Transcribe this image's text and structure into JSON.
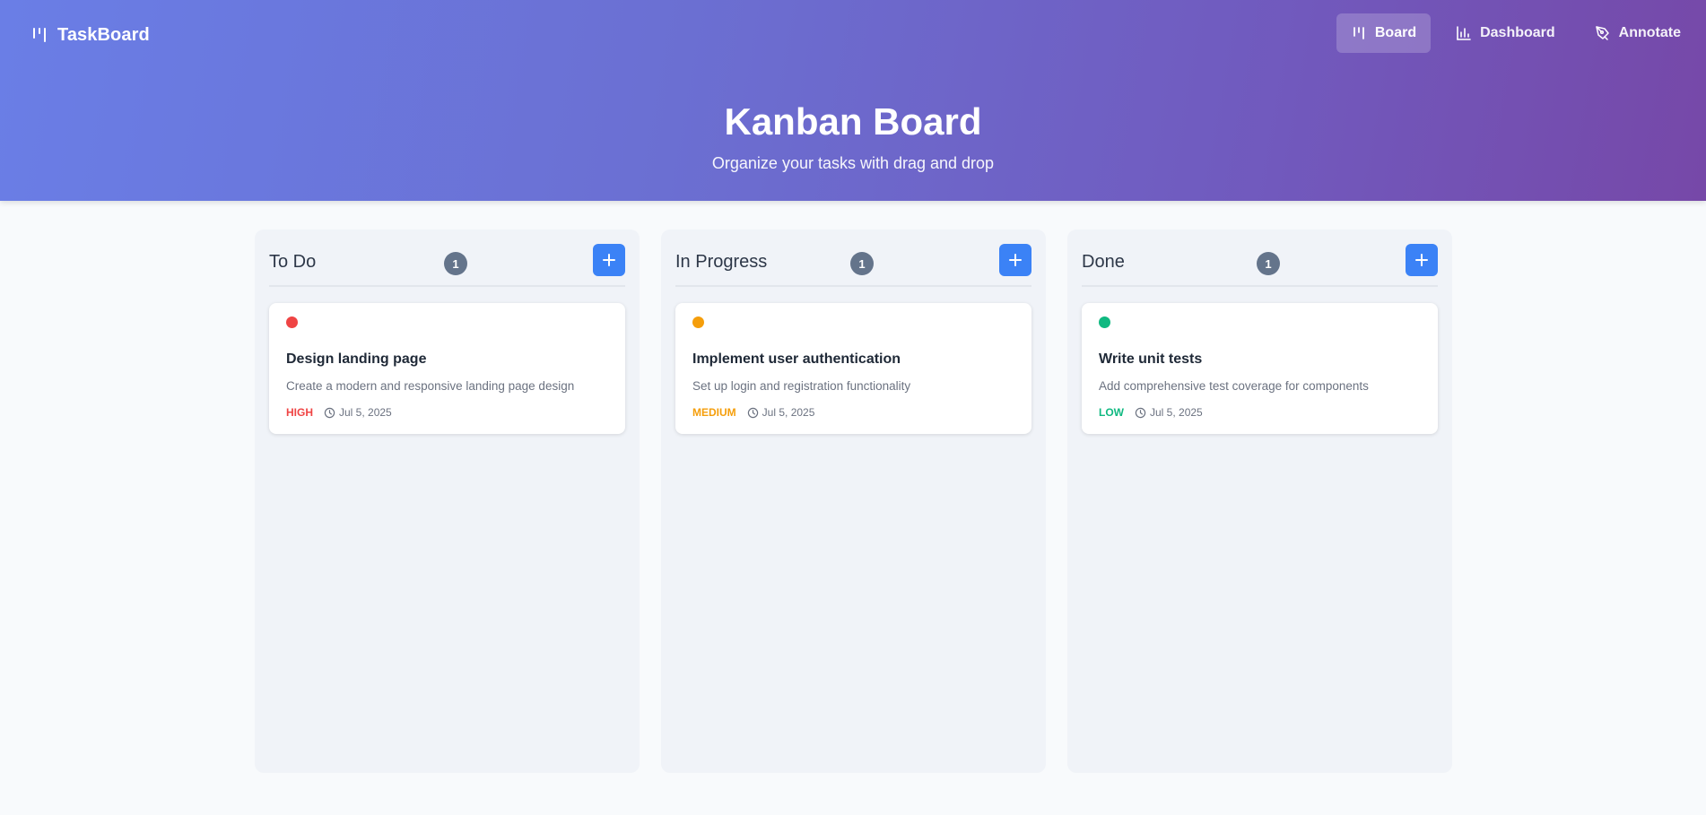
{
  "app": {
    "name": "TaskBoard"
  },
  "nav": {
    "items": [
      {
        "label": "Board",
        "icon": "kanban-icon",
        "active": true
      },
      {
        "label": "Dashboard",
        "icon": "bar-chart-icon",
        "active": false
      },
      {
        "label": "Annotate",
        "icon": "pen-tool-icon",
        "active": false
      }
    ]
  },
  "hero": {
    "title": "Kanban Board",
    "subtitle": "Organize your tasks with drag and drop"
  },
  "columns": [
    {
      "title": "To Do",
      "count": "1",
      "cards": [
        {
          "title": "Design landing page",
          "description": "Create a modern and responsive landing page design",
          "priority": "HIGH",
          "priority_color": "#ef4444",
          "date": "Jul 5, 2025"
        }
      ]
    },
    {
      "title": "In Progress",
      "count": "1",
      "cards": [
        {
          "title": "Implement user authentication",
          "description": "Set up login and registration functionality",
          "priority": "MEDIUM",
          "priority_color": "#f59e0b",
          "date": "Jul 5, 2025"
        }
      ]
    },
    {
      "title": "Done",
      "count": "1",
      "cards": [
        {
          "title": "Write unit tests",
          "description": "Add comprehensive test coverage for components",
          "priority": "LOW",
          "priority_color": "#10b981",
          "date": "Jul 5, 2025"
        }
      ]
    }
  ],
  "colors": {
    "accent": "#3b82f6",
    "count_badge": "#64748b"
  }
}
